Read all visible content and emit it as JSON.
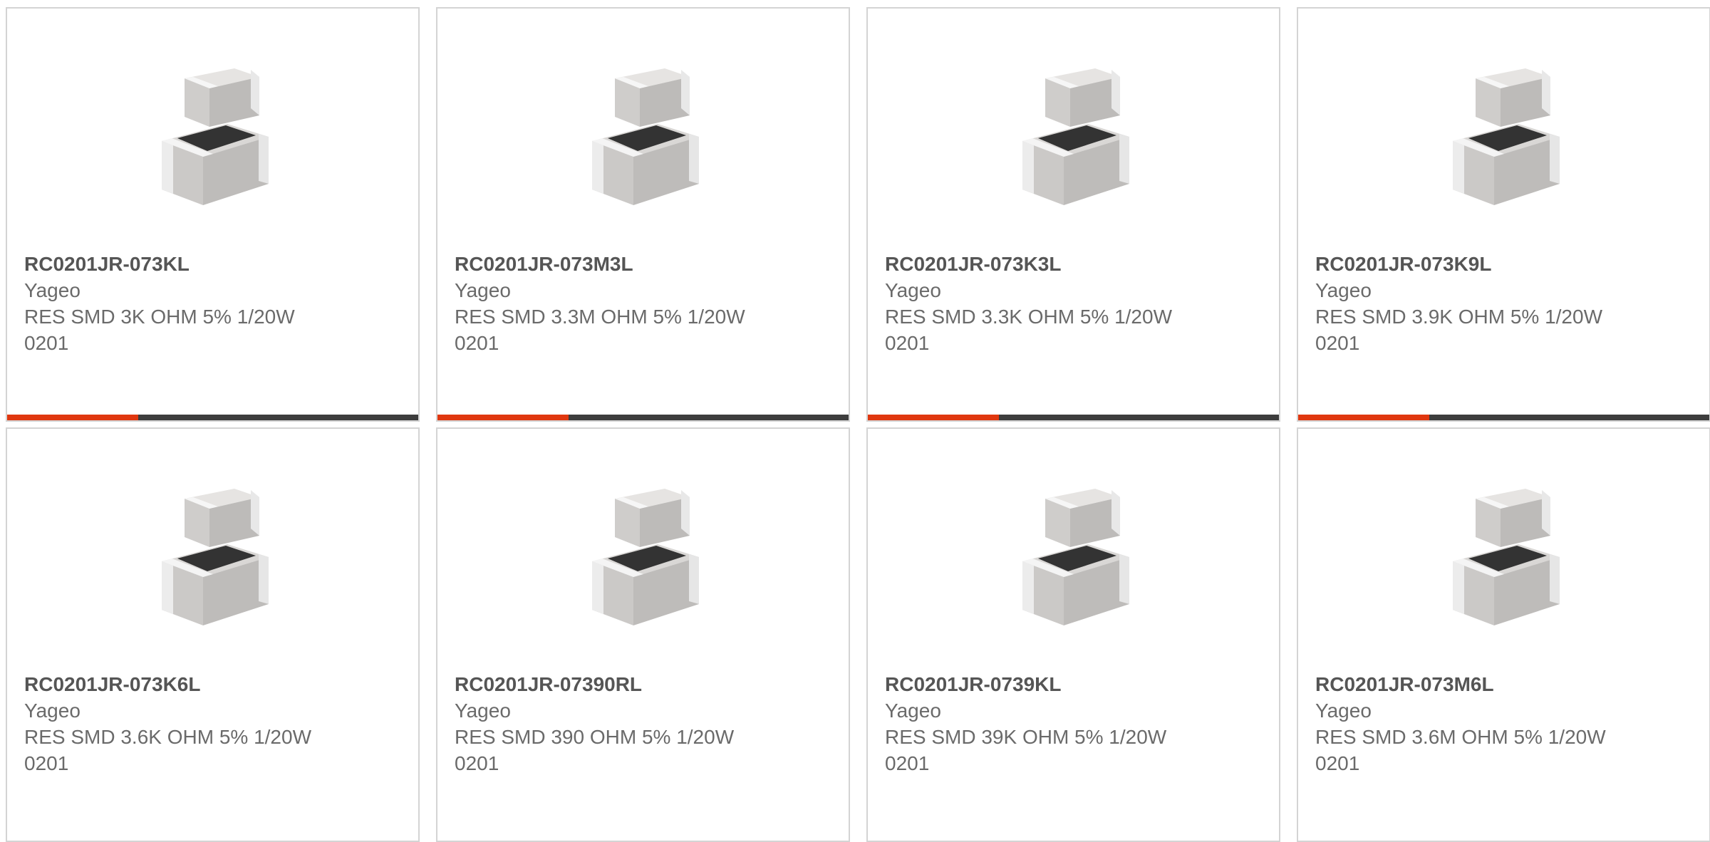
{
  "colors": {
    "accent": "#e0370f",
    "bar_dark": "#3d3d3d",
    "border": "#d4d4d4",
    "text": "#555555"
  },
  "products": [
    {
      "part": "RC0201JR-073KL",
      "manufacturer": "Yageo",
      "description": "RES SMD 3K OHM 5% 1/20W",
      "package": "0201",
      "image_icon": "chip-resistor-image"
    },
    {
      "part": "RC0201JR-073M3L",
      "manufacturer": "Yageo",
      "description": "RES SMD 3.3M OHM 5% 1/20W",
      "package": "0201",
      "image_icon": "chip-resistor-image"
    },
    {
      "part": "RC0201JR-073K3L",
      "manufacturer": "Yageo",
      "description": "RES SMD 3.3K OHM 5% 1/20W",
      "package": "0201",
      "image_icon": "chip-resistor-image"
    },
    {
      "part": "RC0201JR-073K9L",
      "manufacturer": "Yageo",
      "description": "RES SMD 3.9K OHM 5% 1/20W",
      "package": "0201",
      "image_icon": "chip-resistor-image"
    },
    {
      "part": "RC0201JR-073K6L",
      "manufacturer": "Yageo",
      "description": "RES SMD 3.6K OHM 5% 1/20W",
      "package": "0201",
      "image_icon": "chip-resistor-image"
    },
    {
      "part": "RC0201JR-07390RL",
      "manufacturer": "Yageo",
      "description": "RES SMD 390 OHM 5% 1/20W",
      "package": "0201",
      "image_icon": "chip-resistor-image"
    },
    {
      "part": "RC0201JR-0739KL",
      "manufacturer": "Yageo",
      "description": "RES SMD 39K OHM 5% 1/20W",
      "package": "0201",
      "image_icon": "chip-resistor-image"
    },
    {
      "part": "RC0201JR-073M6L",
      "manufacturer": "Yageo",
      "description": "RES SMD 3.6M OHM 5% 1/20W",
      "package": "0201",
      "image_icon": "chip-resistor-image"
    }
  ]
}
